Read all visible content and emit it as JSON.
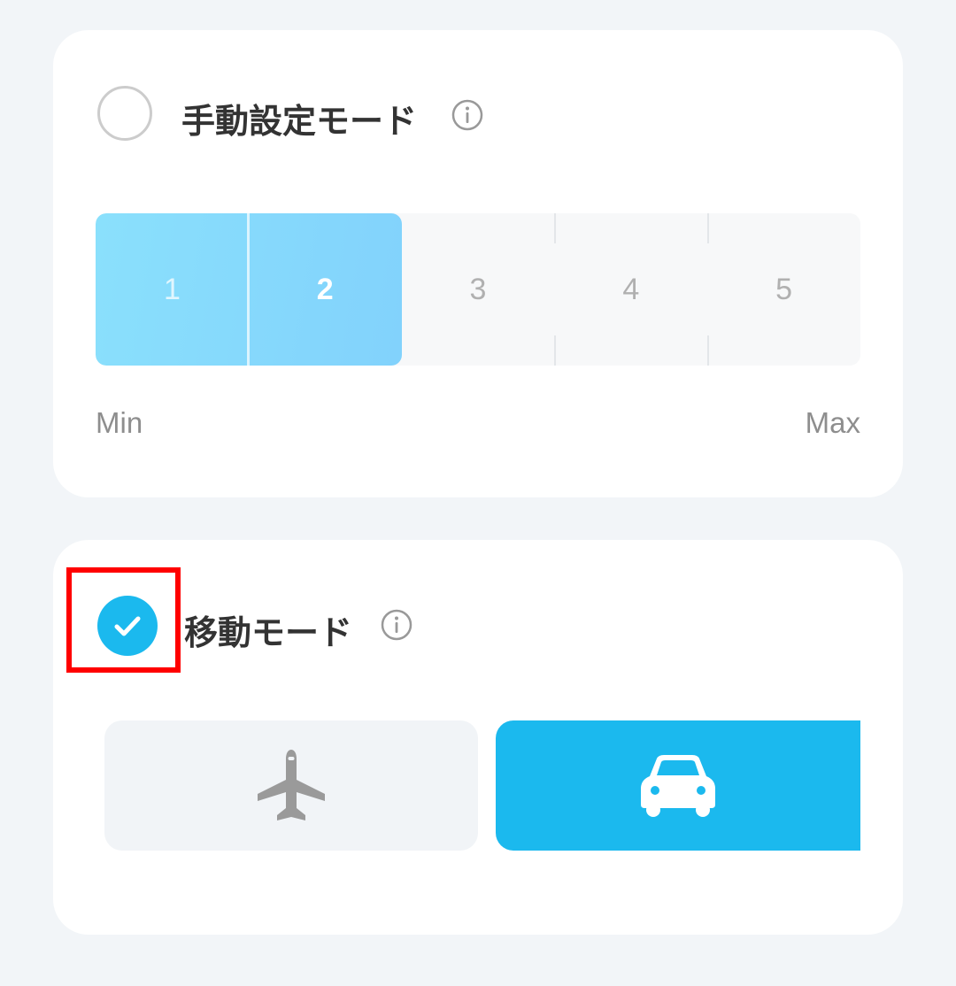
{
  "manual_mode": {
    "title": "手動設定モード",
    "selected": false,
    "info_icon": "info-icon",
    "level": {
      "segments": [
        "1",
        "2",
        "3",
        "4",
        "5"
      ],
      "selected_value": 2,
      "min_label": "Min",
      "max_label": "Max"
    }
  },
  "move_mode": {
    "title": "移動モード",
    "selected": true,
    "info_icon": "info-icon",
    "options": [
      {
        "icon": "airplane-icon",
        "selected": false
      },
      {
        "icon": "car-icon",
        "selected": true
      }
    ]
  },
  "colors": {
    "accent": "#1bb9ee",
    "fill": "#82d2fc",
    "highlight": "#ff0000",
    "background": "#f2f5f8"
  }
}
